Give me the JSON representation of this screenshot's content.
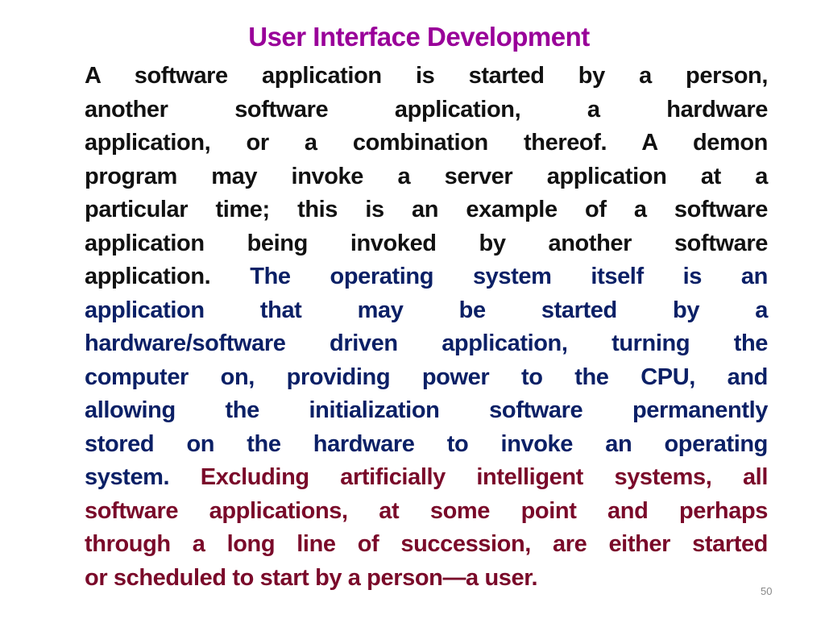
{
  "title": "User Interface Development",
  "colors": {
    "title": "#990099",
    "black": "#111111",
    "navy": "#0b2066",
    "maroon": "#7a0a2a"
  },
  "lines": [
    [
      {
        "t": "A software application is started by a person,",
        "c": "black"
      }
    ],
    [
      {
        "t": "another software application, a hardware",
        "c": "black"
      }
    ],
    [
      {
        "t": "application, or a combination thereof. A demon",
        "c": "black"
      }
    ],
    [
      {
        "t": "program may invoke a server  application at a",
        "c": "black"
      }
    ],
    [
      {
        "t": "particular time; this is an example of a software",
        "c": "black"
      }
    ],
    [
      {
        "t": "application being  invoked by another software",
        "c": "black"
      }
    ],
    [
      {
        "t": "application. ",
        "c": "black"
      },
      {
        "t": "The operating system itself is an",
        "c": "navy"
      }
    ],
    [
      {
        "t": "application  that may be started by a",
        "c": "navy"
      }
    ],
    [
      {
        "t": "hardware/software driven application, turning the",
        "c": "navy"
      }
    ],
    [
      {
        "t": "computer on, providing power to the CPU, and",
        "c": "navy"
      }
    ],
    [
      {
        "t": "allowing the initialization software  permanently",
        "c": "navy"
      }
    ],
    [
      {
        "t": "stored on the hardware to invoke an operating",
        "c": "navy"
      }
    ],
    [
      {
        "t": "system. ",
        "c": "navy"
      },
      {
        "t": "Excluding artificially  intelligent systems, all",
        "c": "maroon"
      }
    ],
    [
      {
        "t": "software applications, at some point and perhaps",
        "c": "maroon"
      }
    ],
    [
      {
        "t": "through a long line of succession, are either started",
        "c": "maroon"
      }
    ],
    [
      {
        "t": "or scheduled to start by a  person—a user.",
        "c": "maroon"
      }
    ]
  ],
  "page_number": "50"
}
